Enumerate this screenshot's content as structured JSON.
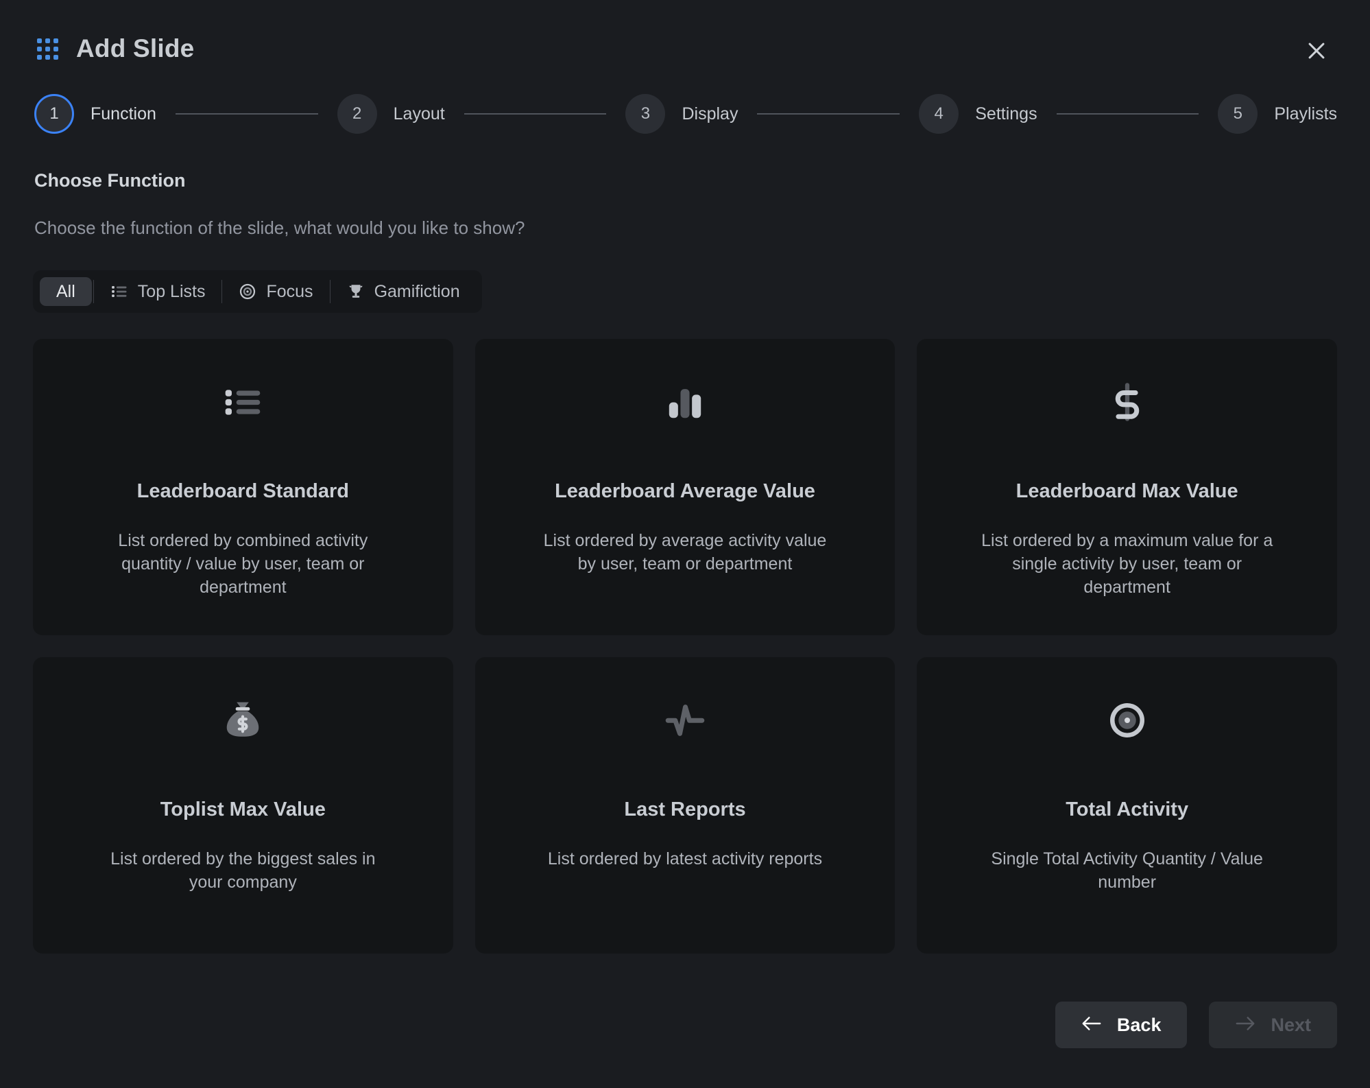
{
  "header": {
    "title": "Add Slide",
    "logo_icon": "grid-dots-icon",
    "close_icon": "close-icon",
    "accent_color": "#4a90e2"
  },
  "stepper": {
    "active_index": 0,
    "active_color": "#3b82f6",
    "steps": [
      {
        "number": "1",
        "label": "Function"
      },
      {
        "number": "2",
        "label": "Layout"
      },
      {
        "number": "3",
        "label": "Display"
      },
      {
        "number": "4",
        "label": "Settings"
      },
      {
        "number": "5",
        "label": "Playlists"
      }
    ]
  },
  "section": {
    "title": "Choose Function",
    "subtitle": "Choose the function of the slide, what would you like to show?"
  },
  "filters": {
    "active": "All",
    "items": [
      {
        "label": "All",
        "icon": "none"
      },
      {
        "label": "Top Lists",
        "icon": "list-icon"
      },
      {
        "label": "Focus",
        "icon": "target-icon"
      },
      {
        "label": "Gamifiction",
        "icon": "trophy-icon"
      }
    ]
  },
  "cards": [
    {
      "icon": "list-icon",
      "title": "Leaderboard Standard",
      "desc": "List ordered by combined activity quantity / value by user, team or department"
    },
    {
      "icon": "bar-chart-icon",
      "title": "Leaderboard Average Value",
      "desc": "List ordered by average activity value by user, team or department"
    },
    {
      "icon": "dollar-sign-icon",
      "title": "Leaderboard Max Value",
      "desc": "List ordered by a maximum value for a single activity by user, team or department"
    },
    {
      "icon": "money-bag-icon",
      "title": "Toplist Max Value",
      "desc": "List ordered by the biggest sales in your company"
    },
    {
      "icon": "pulse-icon",
      "title": "Last Reports",
      "desc": "List ordered by latest activity reports"
    },
    {
      "icon": "bullseye-icon",
      "title": "Total Activity",
      "desc": "Single Total Activity Quantity / Value number"
    }
  ],
  "footer": {
    "back_label": "Back",
    "back_icon": "arrow-left-icon",
    "next_label": "Next",
    "next_icon": "arrow-right-icon",
    "next_disabled": true
  }
}
